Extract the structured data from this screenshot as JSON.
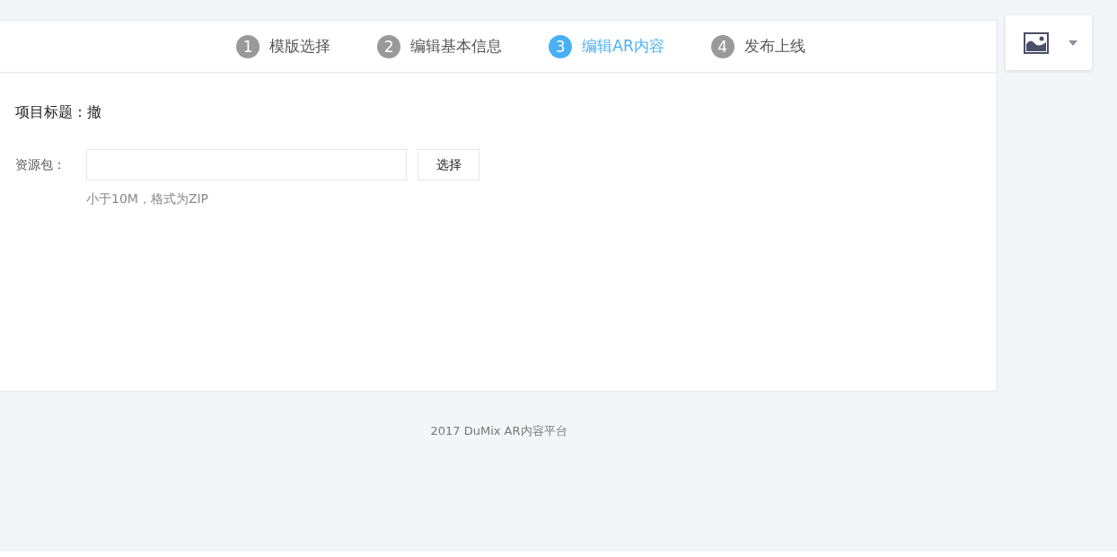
{
  "steps": [
    {
      "number": "1",
      "label": "模版选择",
      "selected": false
    },
    {
      "number": "2",
      "label": "编辑基本信息",
      "selected": false
    },
    {
      "number": "3",
      "label": "编辑AR内容",
      "selected": true
    },
    {
      "number": "4",
      "label": "发布上线",
      "selected": false
    }
  ],
  "project_title": "项目标题：撤",
  "resource": {
    "label": "资源包：",
    "button": "选择",
    "hint": "小于10M，格式为ZIP"
  },
  "footer": "2017 DuMix AR内容平台"
}
